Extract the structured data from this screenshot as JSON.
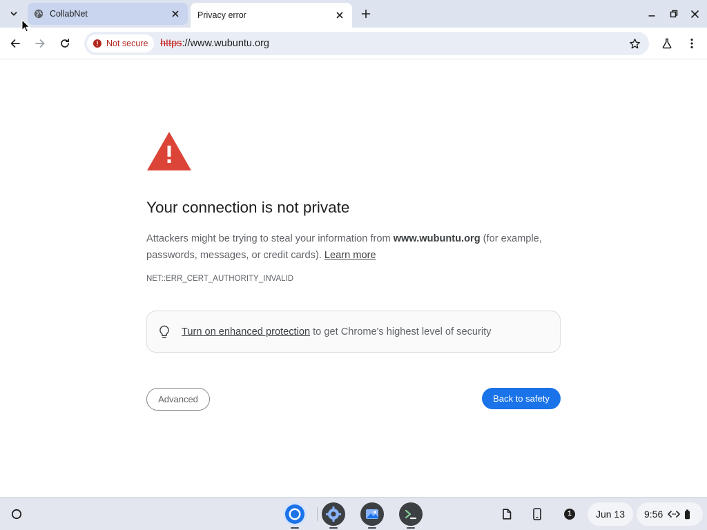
{
  "tabs": [
    {
      "title": "CollabNet",
      "active": false
    },
    {
      "title": "Privacy error",
      "active": true
    }
  ],
  "toolbar": {
    "security_chip": "Not secure",
    "url_scheme": "https",
    "url_rest": "://www.wubuntu.org"
  },
  "page": {
    "heading": "Your connection is not private",
    "desc_before": "Attackers might be trying to steal your information from ",
    "desc_domain": "www.wubuntu.org",
    "desc_after": " (for example, passwords, messages, or credit cards). ",
    "learn_more": "Learn more",
    "error_code": "NET::ERR_CERT_AUTHORITY_INVALID",
    "protection_link": "Turn on enhanced protection",
    "protection_rest": " to get Chrome's highest level of security",
    "advanced_button": "Advanced",
    "back_button": "Back to safety"
  },
  "shelf": {
    "date": "Jun 13",
    "time": "9:56",
    "notification_count": "1",
    "apps": [
      "chrome-icon",
      "settings-icon",
      "gallery-icon",
      "terminal-icon"
    ]
  },
  "colors": {
    "accent": "#1a73e8",
    "danger": "#c5221f",
    "warning_triangle": "#db4437"
  }
}
